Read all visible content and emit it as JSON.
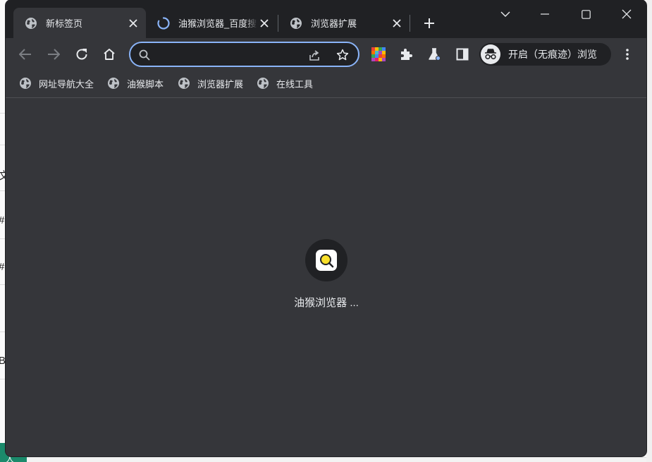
{
  "background_app": {
    "glyphs": [
      "文",
      "#",
      "#",
      "B"
    ],
    "bottom_label": "人"
  },
  "tabs": [
    {
      "title": "新标签页",
      "icon": "globe-icon",
      "active": true
    },
    {
      "title": "油猴浏览器_百度搜索",
      "icon": "loading-spinner-icon",
      "active": false
    },
    {
      "title": "浏览器扩展",
      "icon": "globe-icon",
      "active": false
    }
  ],
  "toolbar": {
    "omnibox_value": "",
    "incognito_label": "开启（无痕迹）浏览"
  },
  "bookmarks": [
    {
      "label": "网址导航大全",
      "icon": "globe-icon"
    },
    {
      "label": "油猴脚本",
      "icon": "globe-icon"
    },
    {
      "label": "浏览器扩展",
      "icon": "globe-icon"
    },
    {
      "label": "在线工具",
      "icon": "globe-icon"
    }
  ],
  "content": {
    "loading_label": "油猴浏览器 ..."
  },
  "colors": {
    "frame": "#202124",
    "toolbar": "#35363a",
    "accent": "#8ab4f8",
    "text": "#e8eaed"
  }
}
